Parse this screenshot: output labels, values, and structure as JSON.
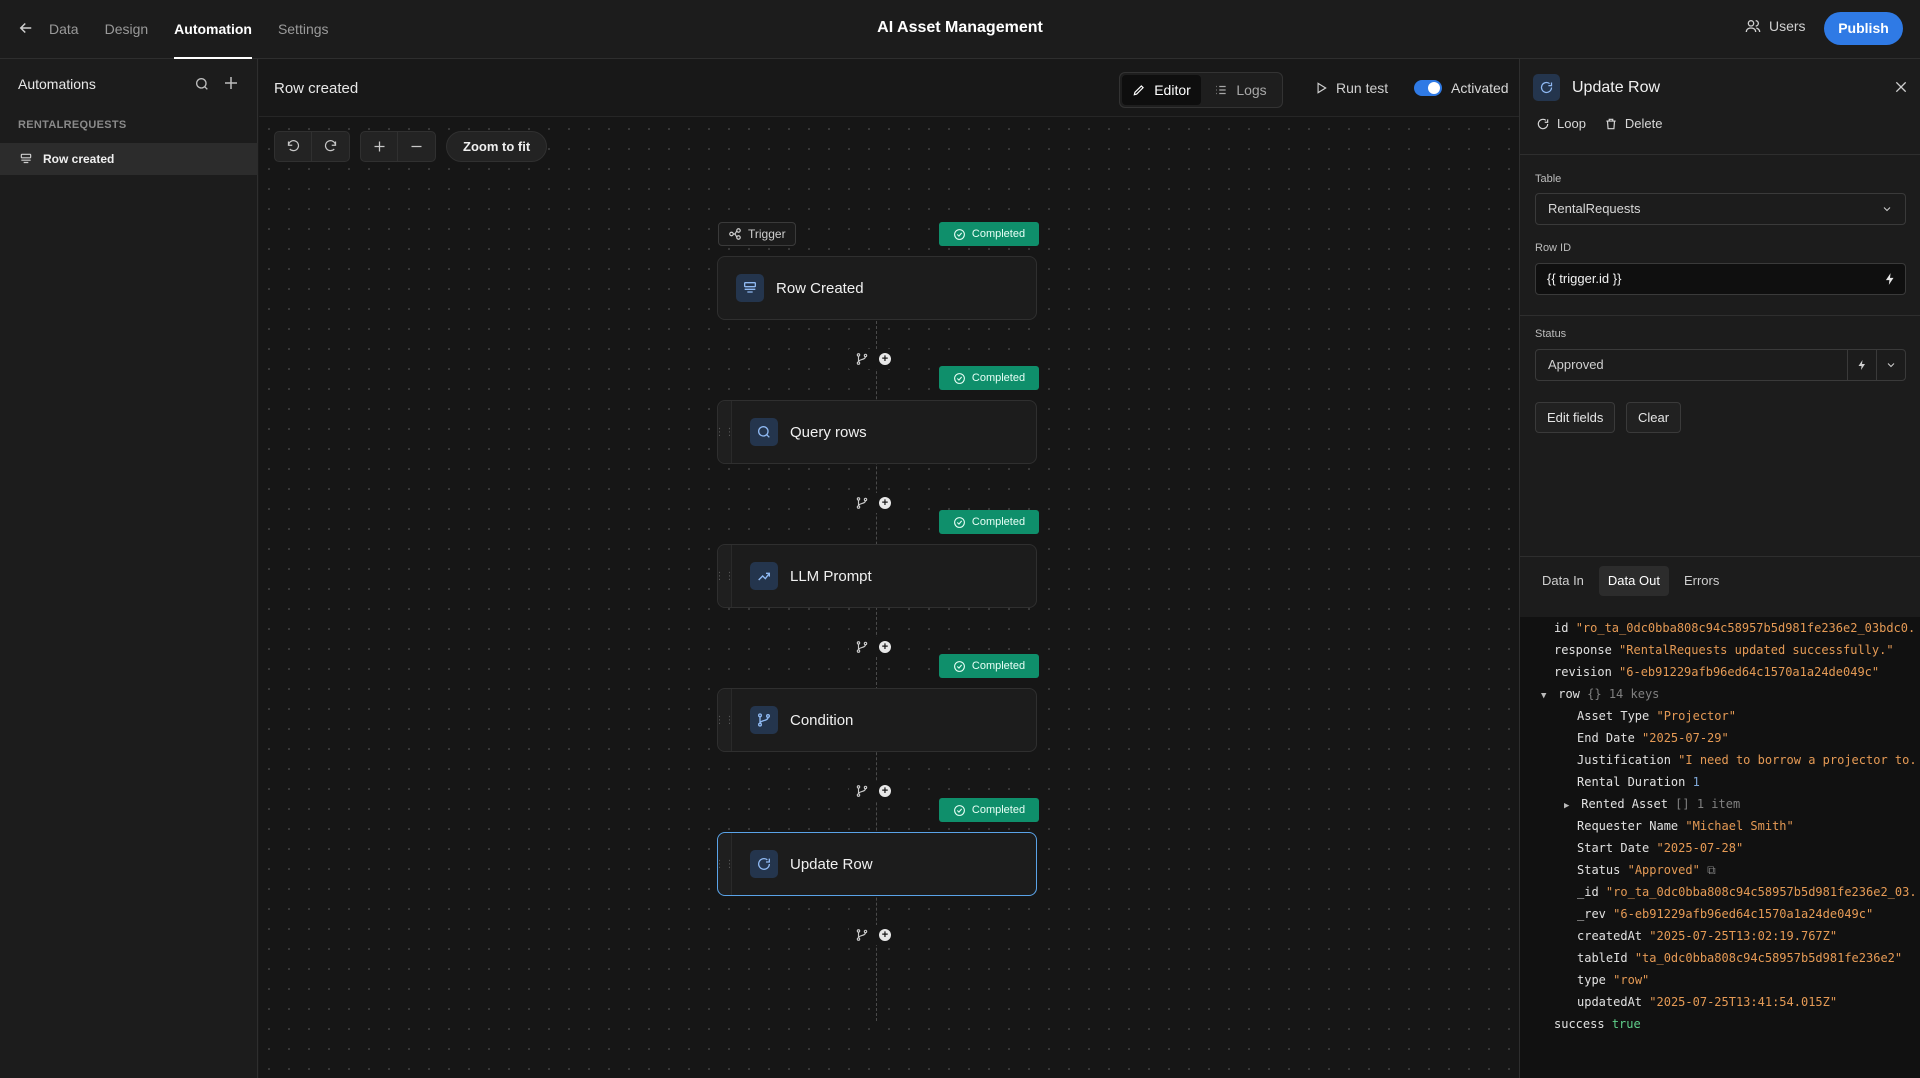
{
  "topbar": {
    "tabs": [
      "Data",
      "Design",
      "Automation",
      "Settings"
    ],
    "active_tab": "Automation",
    "app_title": "AI Asset Management",
    "users_label": "Users",
    "publish_label": "Publish"
  },
  "sidebar": {
    "title": "Automations",
    "section": "RENTALREQUESTS",
    "item": "Row created"
  },
  "canvas": {
    "title": "Row created",
    "editor_label": "Editor",
    "logs_label": "Logs",
    "run_test_label": "Run test",
    "activated_label": "Activated",
    "zoom_fit_label": "Zoom to fit",
    "trigger_label": "Trigger",
    "completed_label": "Completed",
    "nodes": [
      "Row Created",
      "Query rows",
      "LLM Prompt",
      "Condition",
      "Update Row"
    ]
  },
  "panel": {
    "title": "Update Row",
    "loop_label": "Loop",
    "delete_label": "Delete",
    "table_label": "Table",
    "table_value": "RentalRequests",
    "rowid_label": "Row ID",
    "rowid_value": "{{ trigger.id }}",
    "status_label": "Status",
    "status_value": "Approved",
    "edit_fields_label": "Edit fields",
    "clear_label": "Clear",
    "data_tabs": [
      "Data In",
      "Data Out",
      "Errors"
    ],
    "active_data_tab": "Data Out"
  },
  "output": {
    "id_key": "id",
    "id_val": "\"ro_ta_0dc0bba808c94c58957b5d981fe236e2_03bdc0...",
    "response_key": "response",
    "response_val": "\"RentalRequests updated successfully.\"",
    "revision_key": "revision",
    "revision_val": "\"6-eb91229afb96ed64c1570a1a24de049c\"",
    "row_key": "row",
    "row_meta": "{} 14 keys",
    "asset_type_key": "Asset Type",
    "asset_type_val": "\"Projector\"",
    "end_date_key": "End Date",
    "end_date_val": "\"2025-07-29\"",
    "justification_key": "Justification",
    "justification_val": "\"I need to borrow a projector to...",
    "rental_duration_key": "Rental Duration",
    "rental_duration_val": "1",
    "rented_asset_key": "Rented Asset",
    "rented_asset_meta": "[] 1 item",
    "requester_key": "Requester Name",
    "requester_val": "\"Michael Smith\"",
    "start_date_key": "Start Date",
    "start_date_val": "\"2025-07-28\"",
    "status_key": "Status",
    "status_val": "\"Approved\"",
    "_id_key": "_id",
    "_id_val": "\"ro_ta_0dc0bba808c94c58957b5d981fe236e2_03...",
    "_rev_key": "_rev",
    "_rev_val": "\"6-eb91229afb96ed64c1570a1a24de049c\"",
    "created_key": "createdAt",
    "created_val": "\"2025-07-25T13:02:19.767Z\"",
    "tableid_key": "tableId",
    "tableid_val": "\"ta_0dc0bba808c94c58957b5d981fe236e2\"",
    "type_key": "type",
    "type_val": "\"row\"",
    "updated_key": "updatedAt",
    "updated_val": "\"2025-07-25T13:41:54.015Z\"",
    "success_key": "success",
    "success_val": "true"
  },
  "icons": {
    "back": "arrow-left-icon",
    "users": "users-icon",
    "search": "search-icon",
    "add": "plus-icon",
    "editor": "pencil-icon",
    "logs": "list-icon",
    "run": "play-icon",
    "close": "close-icon"
  },
  "colors": {
    "accent": "#2f7ae5",
    "completed": "#0f8f6b",
    "selected_border": "#5aa3e8"
  }
}
